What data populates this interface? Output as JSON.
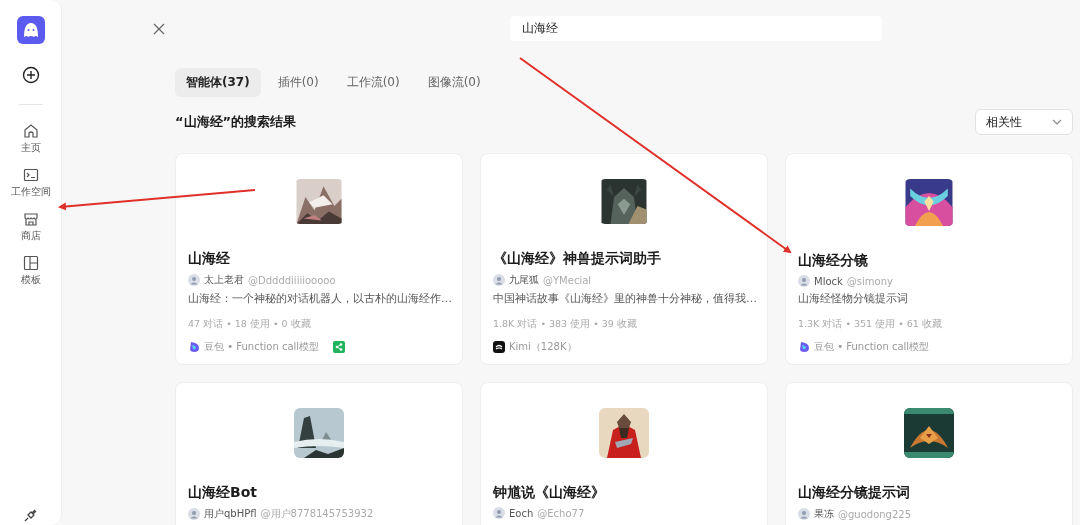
{
  "sidebar": {
    "items": [
      {
        "label": "主页",
        "selected": false
      },
      {
        "label": "工作空间",
        "selected": false
      },
      {
        "label": "商店",
        "selected": false
      },
      {
        "label": "模板",
        "selected": false
      }
    ]
  },
  "search": {
    "value": "山海经"
  },
  "tabs": [
    {
      "label": "智能体(37)",
      "selected": true
    },
    {
      "label": "插件(0)",
      "selected": false
    },
    {
      "label": "工作流(0)",
      "selected": false
    },
    {
      "label": "图像流(0)",
      "selected": false
    }
  ],
  "results_heading": "“山海经”的搜索结果",
  "sort": {
    "value": "相关性"
  },
  "cards": [
    {
      "title": "山海经",
      "author": "太上老君",
      "handle": "@Dddddiiiiiooooo",
      "description": "山海经：一个神秘的对话机器人，以古朴的山海经作…",
      "stats": "47 对话 • 18 使用 • 0 收藏",
      "model": {
        "kind": "doubao",
        "label": "豆包 • Function call模型"
      },
      "shared": true
    },
    {
      "title": "《山海经》神兽提示词助手",
      "author": "九尾狐",
      "handle": "@YMecial",
      "description": "中国神话故事《山海经》里的神兽十分神秘，值得我…",
      "stats": "1.8K 对话 • 383 使用 • 39 收藏",
      "model": {
        "kind": "kimi",
        "label": "Kimi（128K）"
      },
      "shared": false
    },
    {
      "title": "山海经分镜",
      "author": "Mlock",
      "handle": "@simony",
      "description": "山海经怪物分镜提示词",
      "stats": "1.3K 对话 • 351 使用 • 61 收藏",
      "model": {
        "kind": "doubao",
        "label": "豆包 • Function call模型"
      },
      "shared": false
    },
    {
      "title": "山海经Bot",
      "author": "用户qbHPfl",
      "handle": "@用户8778145753932"
    },
    {
      "title": "钟馗说《山海经》",
      "author": "Eoch",
      "handle": "@Echo77"
    },
    {
      "title": "山海经分镜提示词",
      "author": "果冻",
      "handle": "@guodong225"
    }
  ]
}
